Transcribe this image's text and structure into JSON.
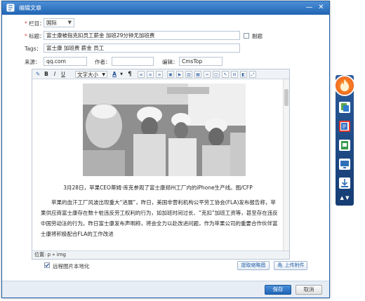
{
  "window": {
    "title": "编辑文章",
    "min_label": "—",
    "close_label": "✕"
  },
  "form": {
    "column_label": "栏目：",
    "column_value": "国际",
    "title_label": "标题：",
    "title_value": "富士康被指克扣员工薪金 加班29分钟无加班费",
    "bold_label": "副题",
    "tags_label": "Tags：",
    "tags_value": "富士康 加班费 薪金 员工",
    "source_label": "来源：",
    "source_value": "qq.com",
    "author_label": "作者：",
    "author_value": "",
    "editor_label": "编辑：",
    "editor_value": "CmsTop"
  },
  "toolbar": {
    "font_size": "文字大小"
  },
  "content": {
    "caption": "3月28日，苹果CEO蒂姆·库克参观了富士康郑州工厂内的iPhone生产线。图/CFP",
    "paragraph": "苹果的血汗工厂风波出现重大“进展”，昨日，美国非营利机构公平劳工协会(FLA)发布报告称，苹果供应商富士康存在数十桩违反劳工权利的行为，如加班时间过长、“克扣”加班工资等，甚至存在违反中国劳动法的行为。昨日富士康发布声明称，将会全力以赴改进问题，作为苹果公司的重要合作伙伴富士康将积极配合FLA的工作改进",
    "path_label": "位置: p » img"
  },
  "bottom": {
    "localize_label": "远程图片本地化",
    "crop_label": "提取缩略图",
    "upload_label": "上传附件"
  },
  "footer": {
    "save_label": "保存",
    "cancel_label": "取消"
  },
  "colors": {
    "titlebar": "#1f64b4",
    "accent": "#4d8fd6",
    "required": "#e04040",
    "sidebar": "#163d74",
    "logo": "#e8541a"
  }
}
